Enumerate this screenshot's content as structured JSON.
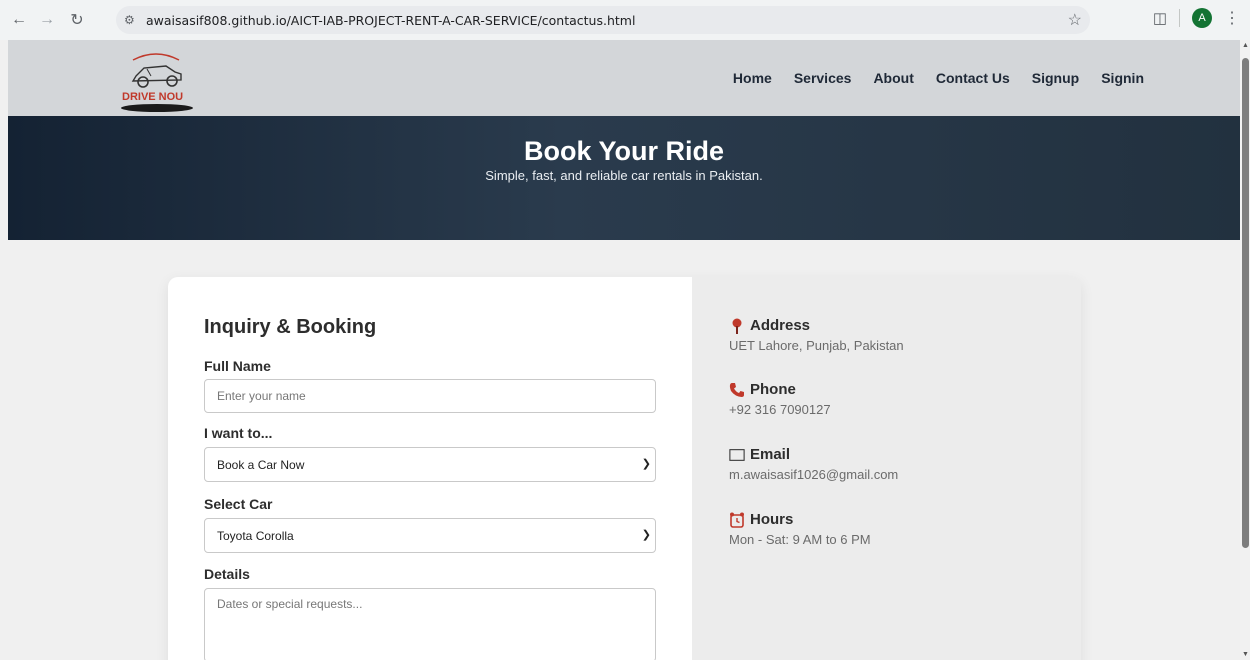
{
  "browser": {
    "url": "awaisasif808.github.io/AICT-IAB-PROJECT-RENT-A-CAR-SERVICE/contactus.html",
    "profile_initial": "A"
  },
  "header": {
    "logo_text": "DRIVE NOU",
    "nav": [
      "Home",
      "Services",
      "About",
      "Contact Us",
      "Signup",
      "Signin"
    ]
  },
  "hero": {
    "title": "Book Your Ride",
    "subtitle": "Simple, fast, and reliable car rentals in Pakistan."
  },
  "form": {
    "title": "Inquiry & Booking",
    "full_name_label": "Full Name",
    "full_name_placeholder": "Enter your name",
    "intent_label": "I want to...",
    "intent_value": "Book a Car Now",
    "car_label": "Select Car",
    "car_value": "Toyota Corolla",
    "details_label": "Details",
    "details_placeholder": "Dates or special requests..."
  },
  "info": {
    "address_title": "Address",
    "address_text": "UET Lahore, Punjab, Pakistan",
    "phone_title": "Phone",
    "phone_text": "+92 316 7090127",
    "email_title": "Email",
    "email_text": "m.awaisasif1026@gmail.com",
    "hours_title": "Hours",
    "hours_text": "Mon - Sat: 9 AM to 6 PM"
  },
  "colors": {
    "header_bg": "#d3d6d9",
    "hero_bg": "#1e2d3d",
    "icon_red": "#c0392b"
  }
}
